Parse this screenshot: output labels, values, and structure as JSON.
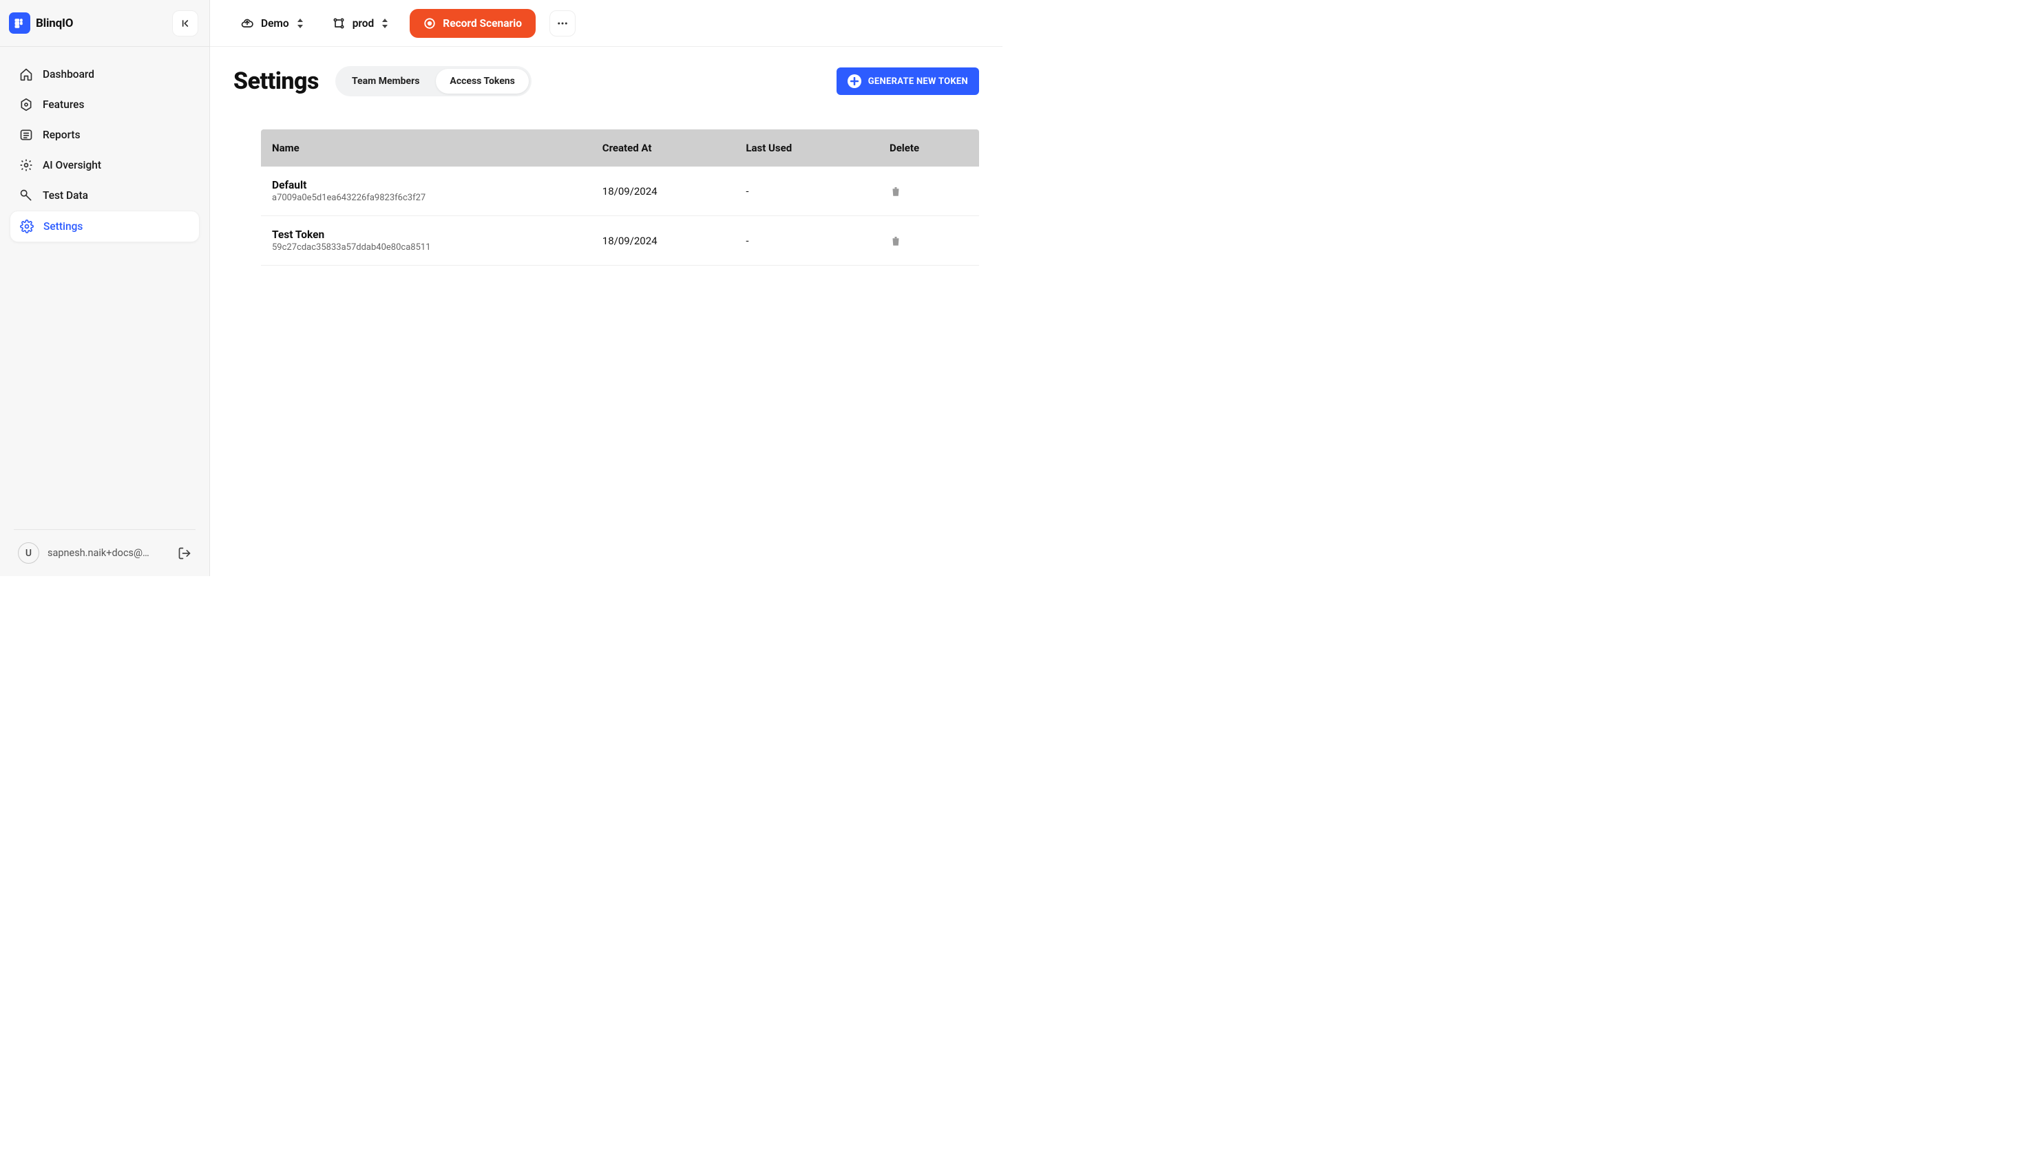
{
  "brand": {
    "name": "BlinqIO"
  },
  "sidebar": {
    "items": [
      {
        "label": "Dashboard",
        "icon": "home"
      },
      {
        "label": "Features",
        "icon": "hex"
      },
      {
        "label": "Reports",
        "icon": "list"
      },
      {
        "label": "AI Oversight",
        "icon": "gear"
      },
      {
        "label": "Test Data",
        "icon": "wrench"
      },
      {
        "label": "Settings",
        "icon": "cog",
        "active": true
      }
    ],
    "user": {
      "initial": "U",
      "email": "sapnesh.naik+docs@…"
    }
  },
  "topbar": {
    "project": "Demo",
    "env": "prod",
    "record_label": "Record Scenario"
  },
  "page": {
    "title": "Settings",
    "tabs": [
      {
        "label": "Team Members"
      },
      {
        "label": "Access Tokens",
        "active": true
      }
    ],
    "generate_label": "GENERATE NEW TOKEN"
  },
  "table": {
    "columns": [
      "Name",
      "Created At",
      "Last Used",
      "Delete"
    ],
    "rows": [
      {
        "name": "Default",
        "hash": "a7009a0e5d1ea643226fa9823f6c3f27",
        "created": "18/09/2024",
        "last_used": "-"
      },
      {
        "name": "Test Token",
        "hash": "59c27cdac35833a57ddab40e80ca8511",
        "created": "18/09/2024",
        "last_used": "-"
      }
    ]
  }
}
